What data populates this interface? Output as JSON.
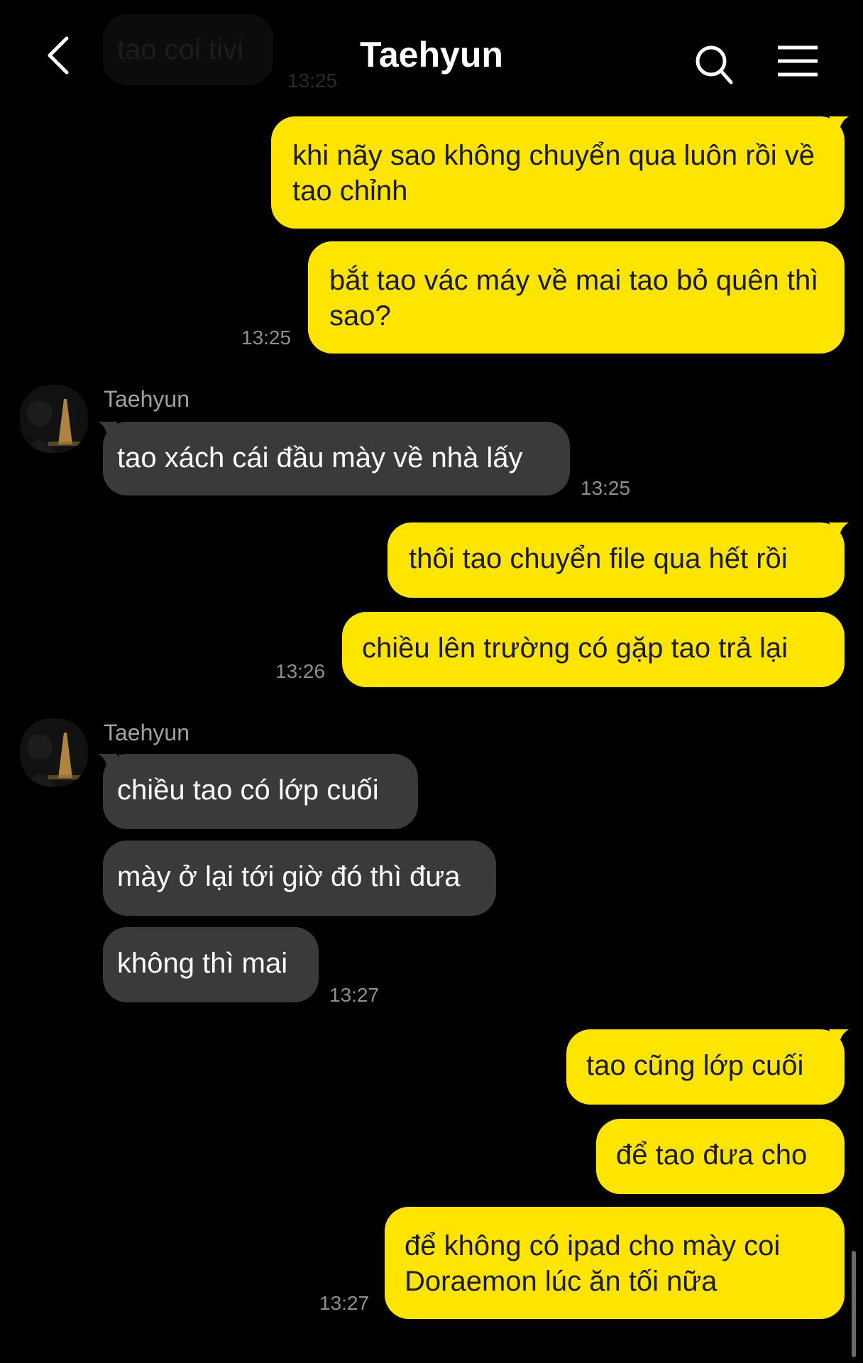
{
  "header": {
    "title": "Taehyun"
  },
  "faded_top": {
    "text": "tao coi tivi",
    "time": "13:25"
  },
  "messages": [
    {
      "text": "khi nãy sao không chuyển qua luôn rồi về tao chỉnh"
    },
    {
      "text": "bắt tao vác máy về mai tao bỏ quên thì sao?",
      "time": "13:25"
    },
    {
      "sender": "Taehyun",
      "text": "tao xách cái đầu mày về nhà lấy",
      "time": "13:25"
    },
    {
      "text": "thôi tao chuyển file qua hết rồi"
    },
    {
      "text": "chiều lên trường có gặp tao trả lại",
      "time": "13:26"
    },
    {
      "sender": "Taehyun",
      "text": "chiều tao có lớp cuối"
    },
    {
      "text": "mày ở lại tới giờ đó thì đưa"
    },
    {
      "text": "không thì mai",
      "time": "13:27"
    },
    {
      "text": "tao cũng lớp cuối"
    },
    {
      "text": "để tao đưa cho"
    },
    {
      "text": "để không có ipad cho mày coi Doraemon lúc ăn tối nữa",
      "time": "13:27"
    }
  ],
  "colors": {
    "background": "#000000",
    "my_bubble": "#fee500",
    "their_bubble": "#3a3a3c",
    "time_text": "#8e8e93"
  },
  "icons": [
    "back-arrow-icon",
    "search-icon",
    "menu-icon",
    "avatar"
  ]
}
